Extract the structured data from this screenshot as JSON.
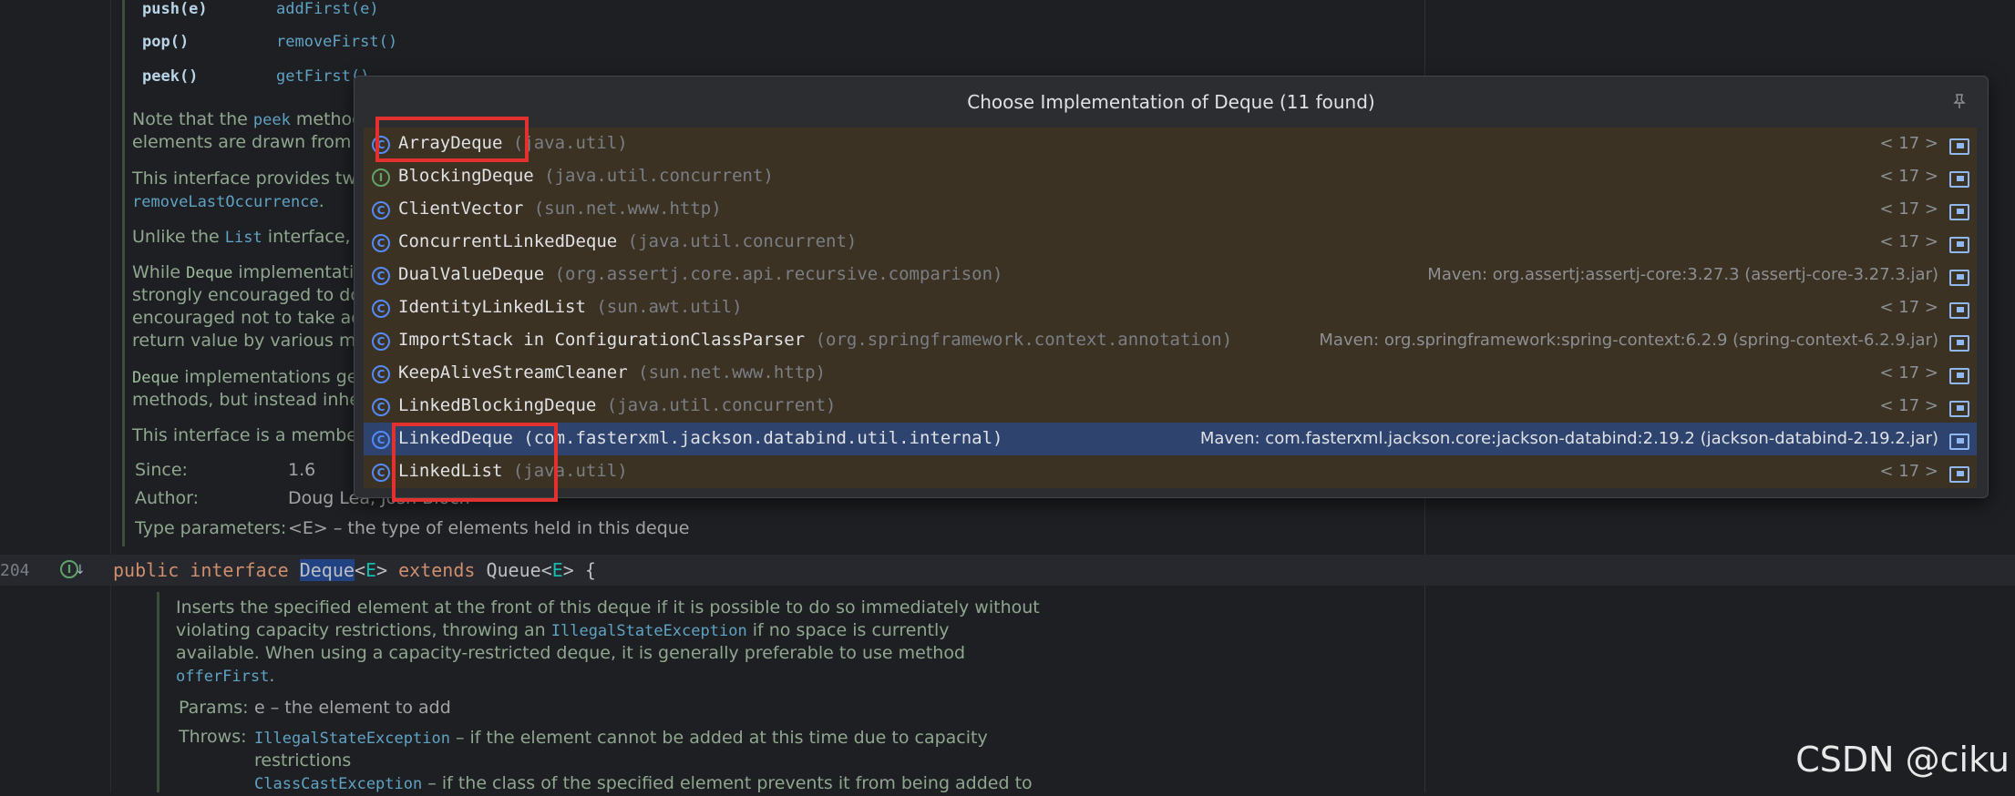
{
  "editor": {
    "alias_table": [
      {
        "stack": "push(e)",
        "deque": "addFirst(e)"
      },
      {
        "stack": "pop()",
        "deque": "removeFirst()"
      },
      {
        "stack": "peek()",
        "deque": "getFirst()"
      }
    ],
    "doc_lines": [
      {
        "pre": "Note that the ",
        "code": "peek",
        "post": " method"
      },
      {
        "pre": "elements are drawn from th",
        "code": "",
        "post": ""
      },
      {
        "pre": "This interface provides two",
        "code": "",
        "post": ""
      },
      {
        "pre": "",
        "code": "removeLastOccurrence",
        "post": "."
      },
      {
        "pre": "Unlike the ",
        "code": "List",
        "post": " interface, t"
      },
      {
        "pre": "While ",
        "code": "Deque",
        "post": " implementatio"
      },
      {
        "pre": "strongly encouraged to do",
        "code": "",
        "post": ""
      },
      {
        "pre": "encouraged not to take adv",
        "code": "",
        "post": ""
      },
      {
        "pre": "return value by various met",
        "code": "",
        "post": ""
      },
      {
        "pre": "",
        "code": "Deque",
        "post": " implementations ge"
      },
      {
        "pre": "methods, but instead inher",
        "code": "",
        "post": ""
      },
      {
        "pre": "This interface is a member",
        "code": "",
        "post": ""
      }
    ],
    "since_label": "Since:",
    "since_value": "1.6",
    "author_label": "Author:",
    "author_value": "Doug Lea, Josh Bloch",
    "type_params_label": "Type parameters:",
    "type_params_value": "<E> – the type of elements held in this deque",
    "line_number": "204",
    "code_tokens": {
      "public": "public",
      "interface": "interface",
      "name": "Deque",
      "generic": "<E>",
      "extends": "extends",
      "parent": "Queue",
      "parent_generic": "<E>",
      "brace": "{"
    },
    "method_doc": [
      "Inserts the specified element at the front of this deque if it is possible to do so immediately without",
      "violating capacity restrictions, throwing an",
      "IllegalStateException",
      "if no space is currently",
      "available. When using a capacity-restricted deque, it is generally preferable to use method",
      "offerFirst",
      "."
    ],
    "params_label": "Params:",
    "params_value": "e – the element to add",
    "throws_label": "Throws:",
    "throws_1_code": "IllegalStateException",
    "throws_1_text": " – if the element cannot be added at this time due to capacity",
    "throws_1_text2": "restrictions",
    "throws_2_code": "ClassCastException",
    "throws_2_text": " – if the class of the specified element prevents it from being added to"
  },
  "popup": {
    "title": "Choose Implementation of Deque (11 found)",
    "pin_icon": "pin-icon",
    "items": [
      {
        "name": "ArrayDeque",
        "pkg": "(java.util)",
        "lib": "< 17 >",
        "kind": "C"
      },
      {
        "name": "BlockingDeque",
        "pkg": "(java.util.concurrent)",
        "lib": "< 17 >",
        "kind": "I"
      },
      {
        "name": "ClientVector",
        "pkg": "(sun.net.www.http)",
        "lib": "< 17 >",
        "kind": "C"
      },
      {
        "name": "ConcurrentLinkedDeque",
        "pkg": "(java.util.concurrent)",
        "lib": "< 17 >",
        "kind": "C"
      },
      {
        "name": "DualValueDeque",
        "pkg": "(org.assertj.core.api.recursive.comparison)",
        "lib": "Maven: org.assertj:assertj-core:3.27.3 (assertj-core-3.27.3.jar)",
        "kind": "C"
      },
      {
        "name": "IdentityLinkedList",
        "pkg": "(sun.awt.util)",
        "lib": "< 17 >",
        "kind": "C"
      },
      {
        "name": "ImportStack in ConfigurationClassParser",
        "pkg": "(org.springframework.context.annotation)",
        "lib": "Maven: org.springframework:spring-context:6.2.9 (spring-context-6.2.9.jar)",
        "kind": "C"
      },
      {
        "name": "KeepAliveStreamCleaner",
        "pkg": "(sun.net.www.http)",
        "lib": "< 17 >",
        "kind": "C"
      },
      {
        "name": "LinkedBlockingDeque",
        "pkg": "(java.util.concurrent)",
        "lib": "< 17 >",
        "kind": "C"
      },
      {
        "name": "LinkedDeque",
        "pkg": "(com.fasterxml.jackson.databind.util.internal)",
        "lib": "Maven: com.fasterxml.jackson.core:jackson-databind:2.19.2 (jackson-databind-2.19.2.jar)",
        "kind": "C"
      },
      {
        "name": "LinkedList",
        "pkg": "(java.util)",
        "lib": "< 17 >",
        "kind": "C"
      }
    ]
  },
  "watermark": "CSDN @ciku"
}
